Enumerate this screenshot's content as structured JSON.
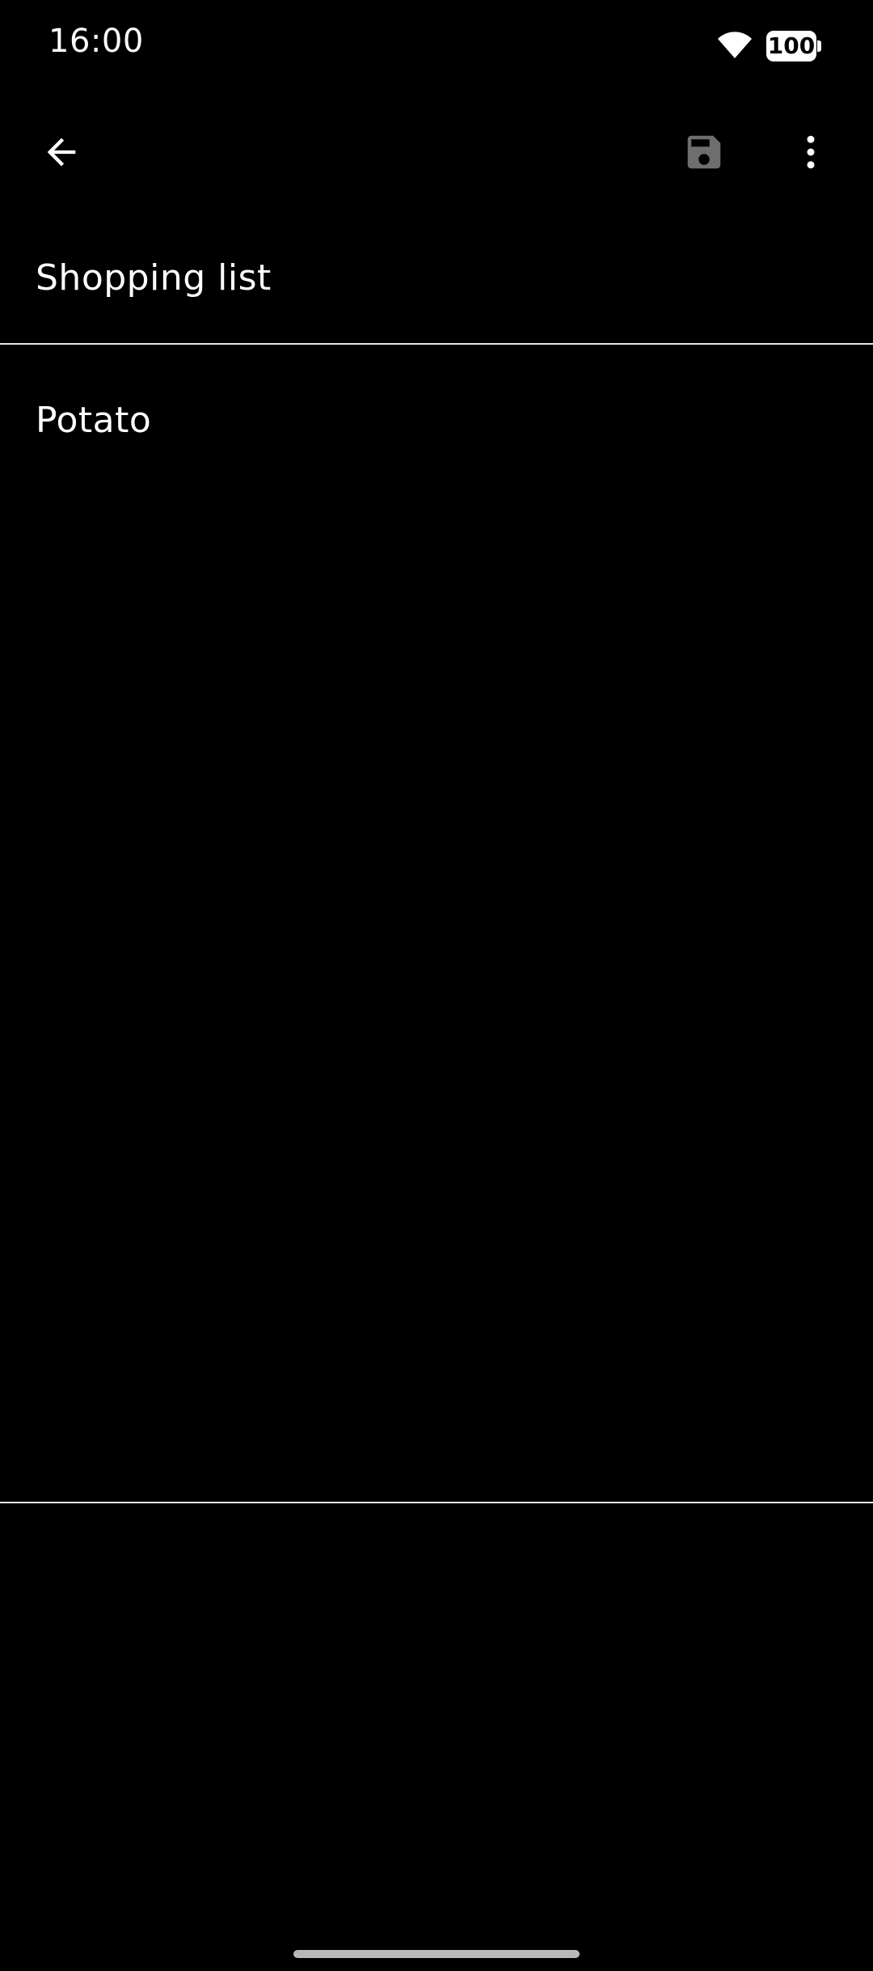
{
  "status_bar": {
    "time": "16:00",
    "battery_level": "100",
    "icons": [
      "wifi-icon",
      "battery-icon"
    ]
  },
  "app_bar": {
    "icons": [
      "back-arrow-icon",
      "save-icon",
      "more-vert-icon"
    ]
  },
  "note": {
    "title": "Shopping list",
    "body": "Potato"
  },
  "colors": {
    "background": "#000000",
    "text": "#ffffff",
    "divider": "#e6e6e6",
    "disabled_icon": "#6e6e6e"
  }
}
